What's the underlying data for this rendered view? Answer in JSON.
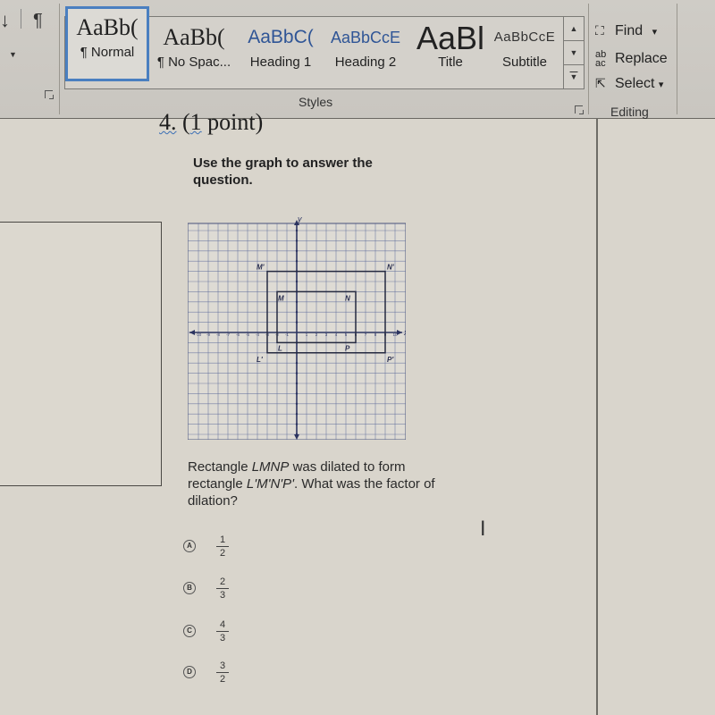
{
  "ribbon": {
    "paragraph": {
      "sort_icon": "↓",
      "pilcrow_icon": "¶"
    },
    "styles": {
      "group_label": "Styles",
      "items": [
        {
          "sample": "AaBb(",
          "name": "¶ Normal",
          "selected": true
        },
        {
          "sample": "AaBb(",
          "name": "¶ No Spac..."
        },
        {
          "sample": "AaBbC(",
          "name": "Heading 1"
        },
        {
          "sample": "AaBbCcE",
          "name": "Heading 2"
        },
        {
          "sample": "AaBl",
          "name": "Title"
        },
        {
          "sample": "AaBbCcE",
          "name": "Subtitle"
        }
      ],
      "scroll": {
        "up": "▲",
        "down": "▼",
        "more": "▼"
      }
    },
    "editing": {
      "group_label": "Editing",
      "find": {
        "icon": "binoculars-icon",
        "label": "Find",
        "caret": "▾"
      },
      "replace": {
        "icon": "replace-icon",
        "label": "Replace"
      },
      "select": {
        "icon": "cursor-arrow-icon",
        "label": "Select",
        "caret": "▾"
      }
    }
  },
  "question": {
    "number": "4.",
    "points_open": "(",
    "points_one": "1",
    "points_rest": " point)",
    "instruction": "Use the graph to answer the question.",
    "text_part1": "Rectangle ",
    "text_lmnp": "LMNP",
    "text_part2": " was dilated to form rectangle ",
    "text_prime": "L'M'N'P'",
    "text_part3": ". What was the factor of dilation?",
    "choices": [
      {
        "letter": "A",
        "num": "1",
        "den": "2"
      },
      {
        "letter": "B",
        "num": "2",
        "den": "3"
      },
      {
        "letter": "C",
        "num": "4",
        "den": "3"
      },
      {
        "letter": "D",
        "num": "3",
        "den": "2"
      }
    ]
  },
  "chart_data": {
    "type": "scatter",
    "title": "",
    "xlabel": "x",
    "ylabel": "y",
    "xlim": [
      -10,
      10
    ],
    "ylim": [
      -10,
      10
    ],
    "grid": true,
    "x_ticks": [
      -10,
      -9,
      -8,
      -7,
      -6,
      -5,
      -4,
      -3,
      -2,
      -1,
      1,
      2,
      3,
      4,
      5,
      6,
      7,
      8,
      9,
      10
    ],
    "series": [
      {
        "name": "LMNP",
        "points": [
          {
            "label": "L",
            "x": -2,
            "y": -1
          },
          {
            "label": "M",
            "x": -2,
            "y": 4
          },
          {
            "label": "N",
            "x": 6,
            "y": 4
          },
          {
            "label": "P",
            "x": 6,
            "y": -1
          }
        ]
      },
      {
        "name": "L'M'N'P'",
        "points": [
          {
            "label": "L'",
            "x": -3,
            "y": -2
          },
          {
            "label": "M'",
            "x": -3,
            "y": 6
          },
          {
            "label": "N'",
            "x": 9,
            "y": 6
          },
          {
            "label": "P'",
            "x": 9,
            "y": -2
          }
        ]
      }
    ]
  }
}
